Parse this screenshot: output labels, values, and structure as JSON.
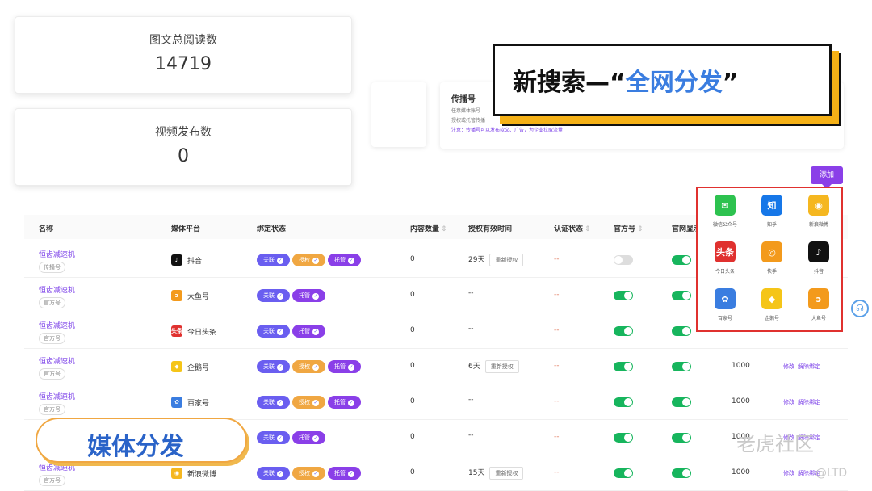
{
  "stats": {
    "reads": {
      "label": "图文总阅读数",
      "value": "14719"
    },
    "videos": {
      "label": "视频发布数",
      "value": "0"
    }
  },
  "broadcast_card": {
    "title": "传播号",
    "line1": "任意媒体账号",
    "line2": "授权或托管传播",
    "note": "注意：传播号可以发布软文、广告，为企业拉取流量"
  },
  "callout": {
    "prefix": "新搜索—“",
    "highlight": "全网分发",
    "suffix": "”"
  },
  "add_button": "添加",
  "table": {
    "headers": {
      "name": "名称",
      "platform": "媒体平台",
      "bind": "绑定状态",
      "content": "内容数量",
      "auth_time": "授权有效时间",
      "verify": "认证状态",
      "official": "官方号",
      "site_show": "官网显示"
    },
    "pill_labels": {
      "link": "关联",
      "auth": "授权",
      "host": "托管"
    },
    "reauth": "重新授权",
    "dash": "--",
    "edit": "修改",
    "unbind": "解除绑定",
    "rows": [
      {
        "name": "恒齿减速机",
        "tag": "传播号",
        "platform": "抖音",
        "content": "0",
        "auth_time": "29天",
        "verify": "--",
        "weight": ""
      },
      {
        "name": "恒齿减速机",
        "tag": "官方号",
        "platform": "大鱼号",
        "content": "0",
        "auth_time": "--",
        "verify": "--",
        "weight": ""
      },
      {
        "name": "恒齿减速机",
        "tag": "官方号",
        "platform": "今日头条",
        "content": "0",
        "auth_time": "--",
        "verify": "--",
        "weight": ""
      },
      {
        "name": "恒齿减速机",
        "tag": "官方号",
        "platform": "企鹅号",
        "content": "0",
        "auth_time": "6天",
        "verify": "--",
        "weight": "1000"
      },
      {
        "name": "恒齿减速机",
        "tag": "官方号",
        "platform": "百家号",
        "content": "0",
        "auth_time": "--",
        "verify": "--",
        "weight": "1000"
      },
      {
        "name": "",
        "tag": "",
        "platform": "",
        "content": "0",
        "auth_time": "--",
        "verify": "--",
        "weight": "1000"
      },
      {
        "name": "恒齿减速机",
        "tag": "官方号",
        "platform": "新浪微博",
        "content": "0",
        "auth_time": "15天",
        "verify": "--",
        "weight": "1000"
      }
    ]
  },
  "platform_popup": [
    {
      "label": "微信公众号",
      "glyph": "✉",
      "color": "#2dc24f",
      "icon": "wechat-icon"
    },
    {
      "label": "知乎",
      "glyph": "知",
      "color": "#1677e8",
      "icon": "zhihu-icon"
    },
    {
      "label": "新浪微博",
      "glyph": "◉",
      "color": "#f5b720",
      "icon": "weibo-icon"
    },
    {
      "label": "今日头条",
      "glyph": "头条",
      "color": "#e0312f",
      "icon": "toutiao-icon"
    },
    {
      "label": "快手",
      "glyph": "◎",
      "color": "#f39a1c",
      "icon": "kuaishou-icon"
    },
    {
      "label": "抖音",
      "glyph": "♪",
      "color": "#111111",
      "icon": "douyin-icon"
    },
    {
      "label": "百家号",
      "glyph": "✿",
      "color": "#3a7de0",
      "icon": "baijiahao-icon"
    },
    {
      "label": "企鹅号",
      "glyph": "◆",
      "color": "#f5c518",
      "icon": "qiehao-icon"
    },
    {
      "label": "大鱼号",
      "glyph": "ɔ",
      "color": "#f39a1c",
      "icon": "dayuhao-icon"
    }
  ],
  "media_label": "媒体分发",
  "watermark": {
    "text": "老虎社区",
    "sub": "@LTD"
  }
}
